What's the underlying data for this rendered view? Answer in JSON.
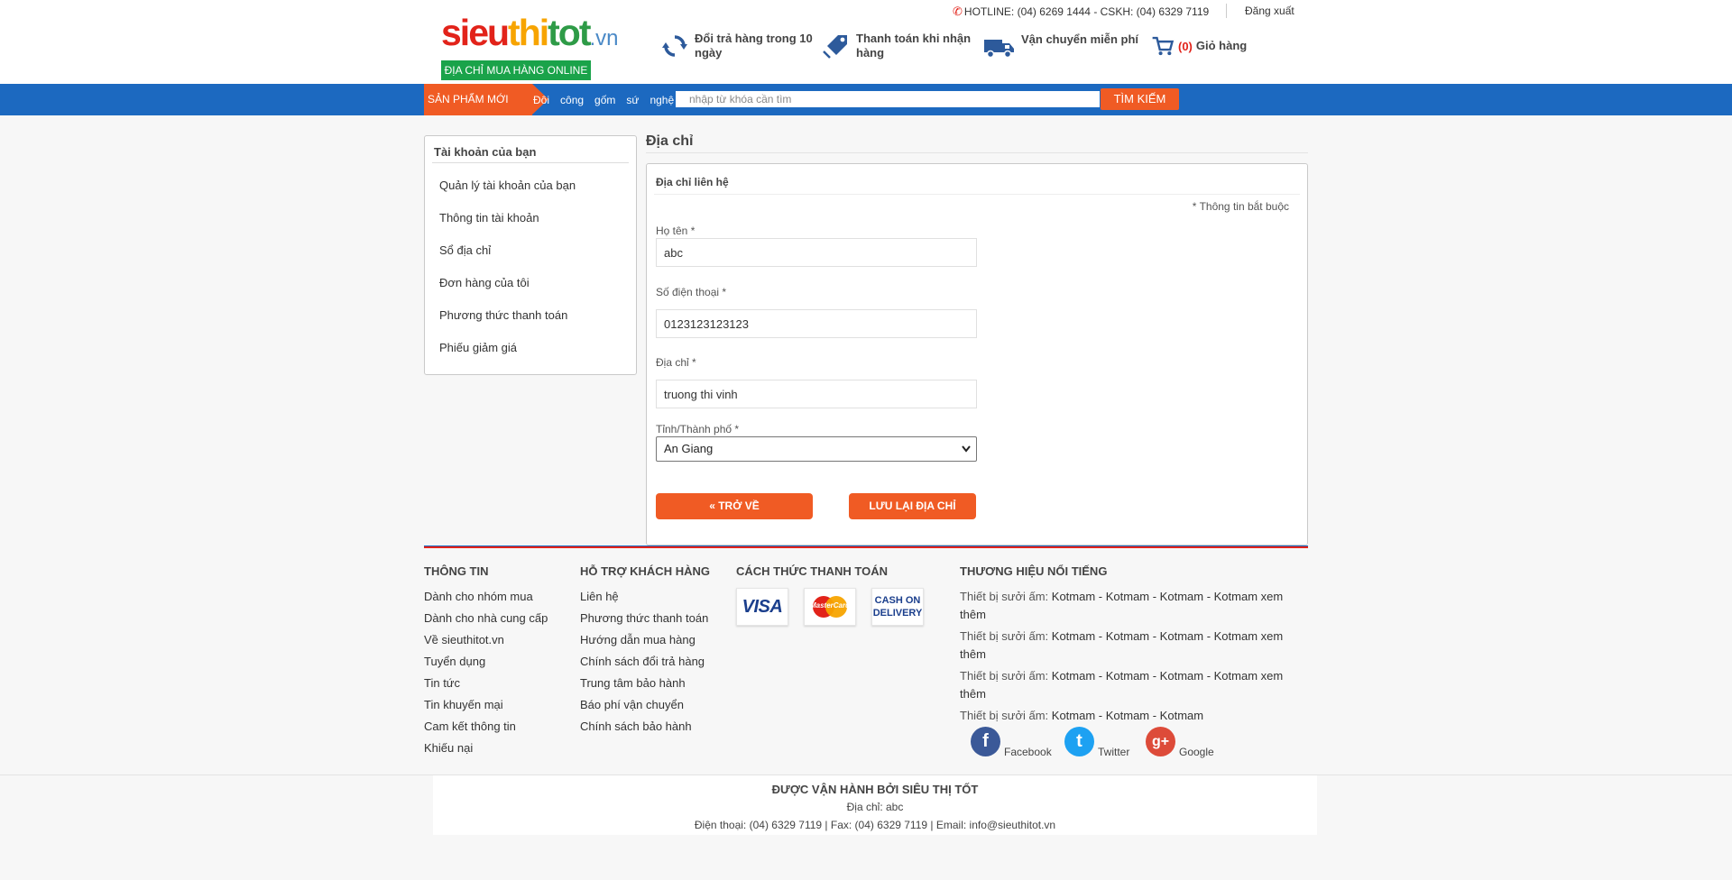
{
  "header": {
    "logo": {
      "part1": "sieu",
      "part2": "thi",
      "part3": "tot",
      "part4": ".vn",
      "tagline": "ĐỊA CHỈ MUA HÀNG ONLINE"
    },
    "hotline": "HOTLINE: (04) 6269 1444 - CSKH: (04) 6329 7119",
    "logout": "Đăng xuất",
    "features": [
      {
        "icon": "refresh-icon",
        "text": "Đổi trả hàng trong 10 ngày"
      },
      {
        "icon": "price-tag-icon",
        "text": "Thanh toán khi nhận hàng"
      },
      {
        "icon": "delivery-truck-icon",
        "text": "Vận chuyển miễn phí"
      }
    ],
    "cart": {
      "icon": "shopping-cart-icon",
      "count": "(0)",
      "label": "Giỏ hàng"
    }
  },
  "nav": {
    "new_products": "SẢN PHẨM MỚI",
    "links": [
      "Đôi",
      "công",
      "gốm",
      "sứ",
      "nghệ"
    ],
    "search_placeholder": "nhập từ khóa cần tìm",
    "search_button": "TÌM KIẾM"
  },
  "sidebar": {
    "title": "Tài khoản của bạn",
    "items": [
      "Quản lý tài khoản của bạn",
      "Thông tin tài khoản",
      "Sổ địa chỉ",
      "Đơn hàng của tôi",
      "Phương thức thanh toán",
      "Phiếu giảm giá"
    ]
  },
  "main": {
    "title": "Địa chỉ",
    "form_title": "Địa chỉ liên hệ",
    "required_note": "* Thông tin bắt buộc",
    "fields": {
      "name": {
        "label": "Họ tên *",
        "value": "abc"
      },
      "phone": {
        "label": "Số điện thoại *",
        "value": "0123123123123"
      },
      "address": {
        "label": "Địa chỉ *",
        "value": "truong thi vinh"
      },
      "city": {
        "label": "Tỉnh/Thành phố *",
        "value": "An Giang"
      }
    },
    "back_button": "« TRỞ VỀ",
    "save_button": "LƯU LẠI ĐỊA CHỈ"
  },
  "footer": {
    "info": {
      "title": "THÔNG TIN",
      "links": [
        "Dành cho nhóm mua",
        "Dành cho nhà cung cấp",
        "Về sieuthitot.vn",
        "Tuyển dụng",
        "Tin tức",
        "Tin khuyến mại",
        "Cam kết thông tin",
        "Khiếu nại"
      ]
    },
    "support": {
      "title": "HỖ TRỢ KHÁCH HÀNG",
      "links": [
        "Liên hệ",
        "Phương thức thanh toán",
        "Hướng dẫn mua hàng",
        "Chính sách đổi trả hàng",
        "Trung tâm bảo hành",
        "Báo phí vận chuyển",
        "Chính sách bảo hành"
      ]
    },
    "payment": {
      "title": "CÁCH THỨC THANH TOÁN",
      "visa": "VISA",
      "mastercard": "MasterCard",
      "cod": [
        "CASH ON",
        "DELIVERY"
      ]
    },
    "brands": {
      "title": "THƯƠNG HIỆU NỔI TIẾNG",
      "lines": [
        {
          "label": "Thiết bị sưởi ấm:",
          "links": " Kotmam - Kotmam - Kotmam - Kotmam xem thêm"
        },
        {
          "label": "Thiết bị sưởi ấm:",
          "links": " Kotmam - Kotmam - Kotmam - Kotmam xem thêm"
        },
        {
          "label": "Thiết bị sưởi ấm:",
          "links": " Kotmam - Kotmam - Kotmam - Kotmam xem thêm"
        },
        {
          "label": "Thiết bị sưởi ấm:",
          "links": " Kotmam - Kotmam - Kotmam"
        }
      ]
    },
    "social": [
      {
        "name": "Facebook",
        "icon": "facebook-icon",
        "color": "#3b5998",
        "glyph": "f"
      },
      {
        "name": "Twitter",
        "icon": "twitter-icon",
        "color": "#1da1f2",
        "glyph": "t"
      },
      {
        "name": "Google",
        "icon": "google-plus-icon",
        "color": "#dd4b39",
        "glyph": "g+"
      }
    ],
    "bottom": {
      "operated_by": "ĐƯỢC VẬN HÀNH BỞI SIÊU THỊ TỐT",
      "address": "Địa chỉ: abc",
      "contact": "Điện thoại: (04) 6329 7119 | Fax: (04) 6329 7119 | Email: info@sieuthitot.vn"
    }
  },
  "colors": {
    "brand_blue": "#1c69c0",
    "accent_orange": "#f05b24",
    "brand_red": "#e2231a",
    "brand_green": "#1aa34a"
  }
}
